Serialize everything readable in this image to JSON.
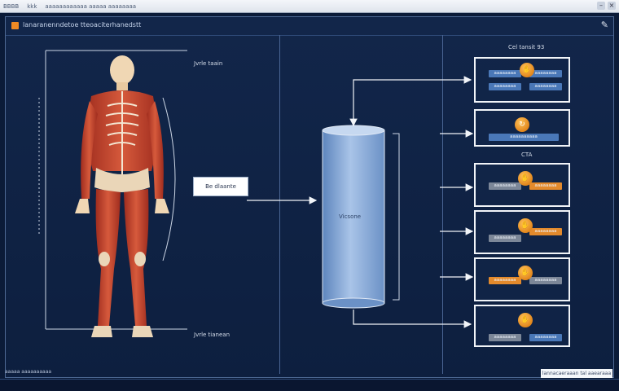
{
  "window": {
    "chrome_items": [
      "BBBB",
      "kkk",
      "aaaaaaaaaaaa aaaaa aaaaaaaa"
    ],
    "title": "lanaranenndetoe tteoaciterhanedstt"
  },
  "diagram": {
    "top_label": "Jvrle taain",
    "bottom_label": "Jvrle tianean",
    "input_box_label": "Be dlaante",
    "cylinder_label": "Vicsone",
    "cards_title": "Cel tansit 93",
    "section_label": "CTA"
  },
  "cards": [
    {
      "chips": [
        "aaaaaaaa",
        "aaaaaaaa",
        "aaaaaaaa",
        "aaaaaaaa"
      ]
    },
    {
      "chips": [
        "aaaaaaaaaa"
      ]
    },
    {
      "chips": [
        "aaaaaaaa",
        "aaaaaaaa"
      ]
    },
    {
      "chips": [
        "aaaaaaaa",
        "aaaaaaaa"
      ]
    },
    {
      "chips": [
        "aaaaaaaa",
        "aaaaaaaa"
      ]
    },
    {
      "chips": [
        "aaaaaaaa",
        "aaaaaaaa"
      ]
    }
  ],
  "footer": {
    "left_text": "aaaaa aaaaaaaaaa",
    "status": "lannacaeraaan tal aaearaaa"
  },
  "colors": {
    "background": "#0b1b38",
    "accent_orange": "#e38a2c",
    "accent_blue": "#4a78b8",
    "muscle_red": "#c8412e"
  }
}
